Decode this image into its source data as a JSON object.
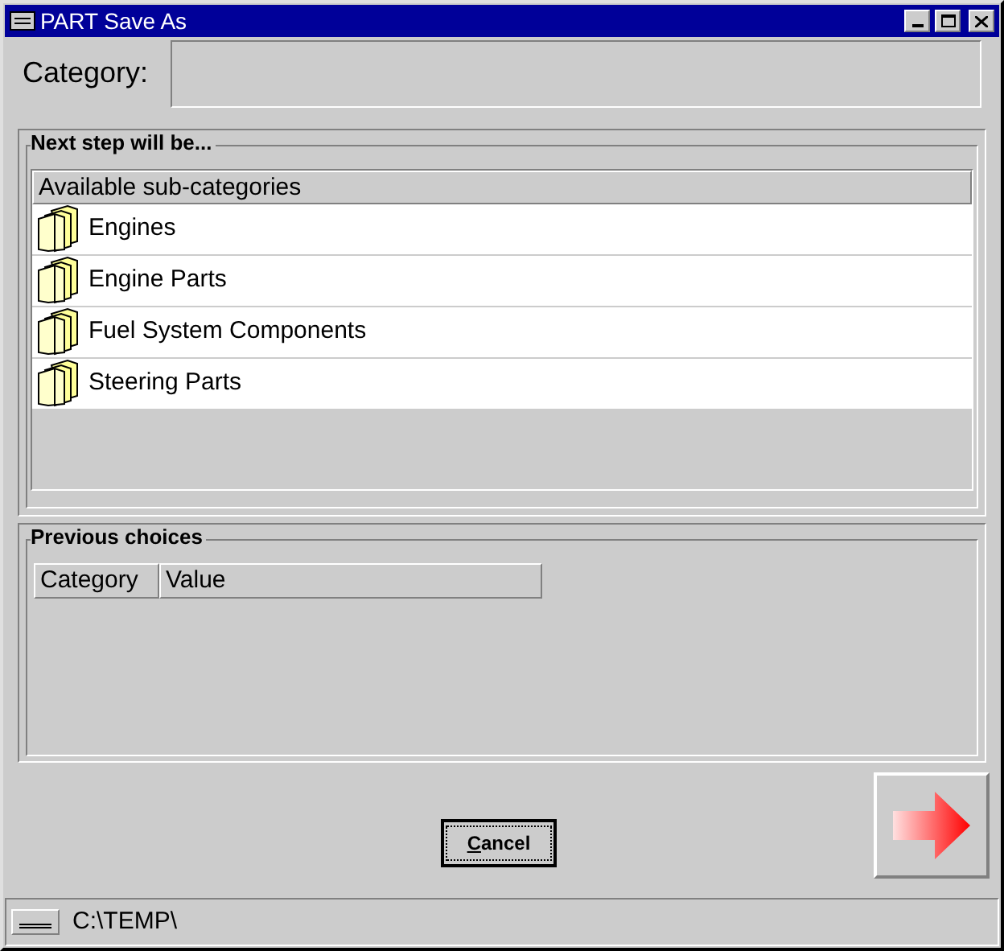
{
  "window": {
    "title": "PART Save As"
  },
  "category": {
    "label": "Category:"
  },
  "next_step": {
    "title": "Next step will be...",
    "header": "Available sub-categories",
    "items": [
      {
        "label": "Engines"
      },
      {
        "label": "Engine Parts"
      },
      {
        "label": "Fuel System Components"
      },
      {
        "label": "Steering Parts"
      }
    ]
  },
  "previous_choices": {
    "title": "Previous choices",
    "columns": [
      "Category",
      "Value"
    ]
  },
  "buttons": {
    "cancel": "Cancel"
  },
  "status_bar": {
    "path": "C:\\TEMP\\"
  }
}
